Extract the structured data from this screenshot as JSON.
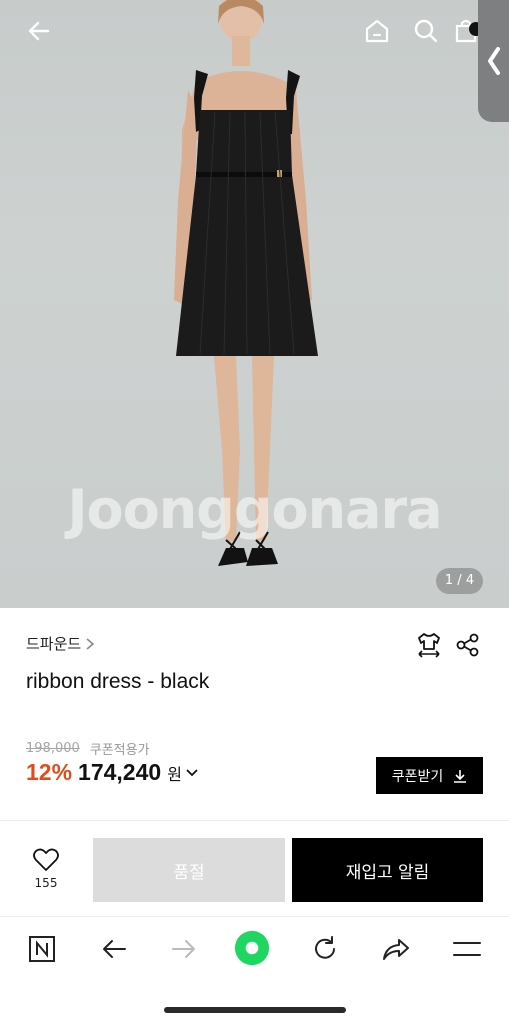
{
  "header": {
    "icons": [
      "back-arrow-icon",
      "home-icon",
      "search-icon",
      "shopping-bag-icon"
    ],
    "side_tab_icon": "chevron-left-icon"
  },
  "hero": {
    "watermark": "Joonggonara",
    "page_indicator": "1 / 4"
  },
  "product": {
    "brand": "드파운드",
    "title": "ribbon dress - black",
    "original_price": "198,000",
    "coupon_note": "쿠폰적용가",
    "discount": "12%",
    "price": "174,240",
    "currency": "원",
    "coupon_button": "쿠폰받기",
    "icons": [
      "size-guide-shirt-icon",
      "share-icon"
    ]
  },
  "actions": {
    "like_count": "155",
    "soldout_label": "품절",
    "restock_label": "재입고 알림"
  },
  "browser_bar": {
    "icons": [
      "naver-n-icon",
      "back-icon",
      "forward-icon",
      "green-dot-icon",
      "refresh-icon",
      "share-arrow-icon",
      "menu-icon"
    ]
  },
  "colors": {
    "accent_discount": "#e24c1c",
    "green_dot": "#1ed760",
    "dark": "#000000"
  }
}
